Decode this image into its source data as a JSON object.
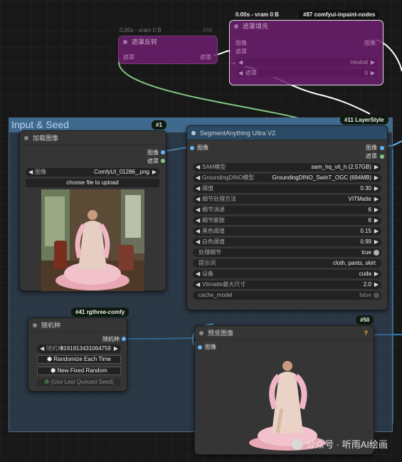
{
  "canvas": {
    "group_title": "Input & Seed"
  },
  "purple_node_69": {
    "status": "0.00s - vram 0 B",
    "id_chip": "#69",
    "title": "遮罩反转",
    "input_label": "遮罩",
    "output_label": "遮罩"
  },
  "purple_node_87": {
    "status": "0.00s - vram 0 B",
    "id_chip": "#87 comfyui-inpaint-nodes",
    "title": "遮罩填充",
    "input_image": "图像",
    "input_mask": "遮罩",
    "output_image": "图像",
    "row1_value": "neutral",
    "row2_label": "遮罩",
    "row2_value": "0"
  },
  "load_image_node": {
    "id_chip": "#1",
    "title": "加载图像",
    "output_image": "图像",
    "output_mask": "遮罩",
    "image_widget_label": "图像",
    "image_widget_value": "ComfyUI_01286_.png",
    "upload_button": "choose file to upload"
  },
  "segment_node": {
    "id_chip": "#11 LayerStyle",
    "title": "SegmentAnything Ultra V2",
    "input_image": "图像",
    "output_image": "图像",
    "output_mask": "遮罩",
    "widgets": [
      {
        "label": "SAM模型",
        "value": "sam_hq_vit_h (2.57GB)"
      },
      {
        "label": "GroundingDINO模型",
        "value": "GroundingDINO_SwinT_OGC (694MB)"
      },
      {
        "label": "阈值",
        "value": "0.30"
      },
      {
        "label": "细节处理方法",
        "value": "VITMatte"
      },
      {
        "label": "细节消退",
        "value": "6"
      },
      {
        "label": "细节膨胀",
        "value": "6"
      },
      {
        "label": "黑色阈值",
        "value": "0.15"
      },
      {
        "label": "白色阈值",
        "value": "0.99"
      }
    ],
    "toggle_label": "处理细节",
    "toggle_value": "true",
    "prompt_label": "提示词",
    "prompt_value": "cloth, pants, skirt",
    "device_label": "设备",
    "device_value": "cuda",
    "vitmatte_label": "Vitmatte最大尺寸",
    "vitmatte_value": "2.0",
    "cache_label": "cache_model",
    "cache_value": "false"
  },
  "seed_node": {
    "id_chip": "#41 rgthree-comfy",
    "title": "随机种",
    "output_label": "随机种",
    "seed_label": "随机种",
    "seed_value": "8191913431064759",
    "btn_randomize": "Randomize Each Time",
    "btn_fixed": "New Fixed Random",
    "btn_last": "(Use Last Queued Seed)",
    "dice_icon": "dice-icon",
    "recycle_icon": "recycle-icon"
  },
  "preview_node": {
    "id_chip": "#50",
    "title": "预览图像",
    "input_image": "图像",
    "help_glyph": "?"
  },
  "watermark": {
    "text": "公众号 · 听雨AI绘画"
  },
  "colors": {
    "image_link": "#64b5f6",
    "mask_link": "#81c784",
    "purple_node": "#6e1e6e",
    "group_header": "#3f6a8e"
  }
}
